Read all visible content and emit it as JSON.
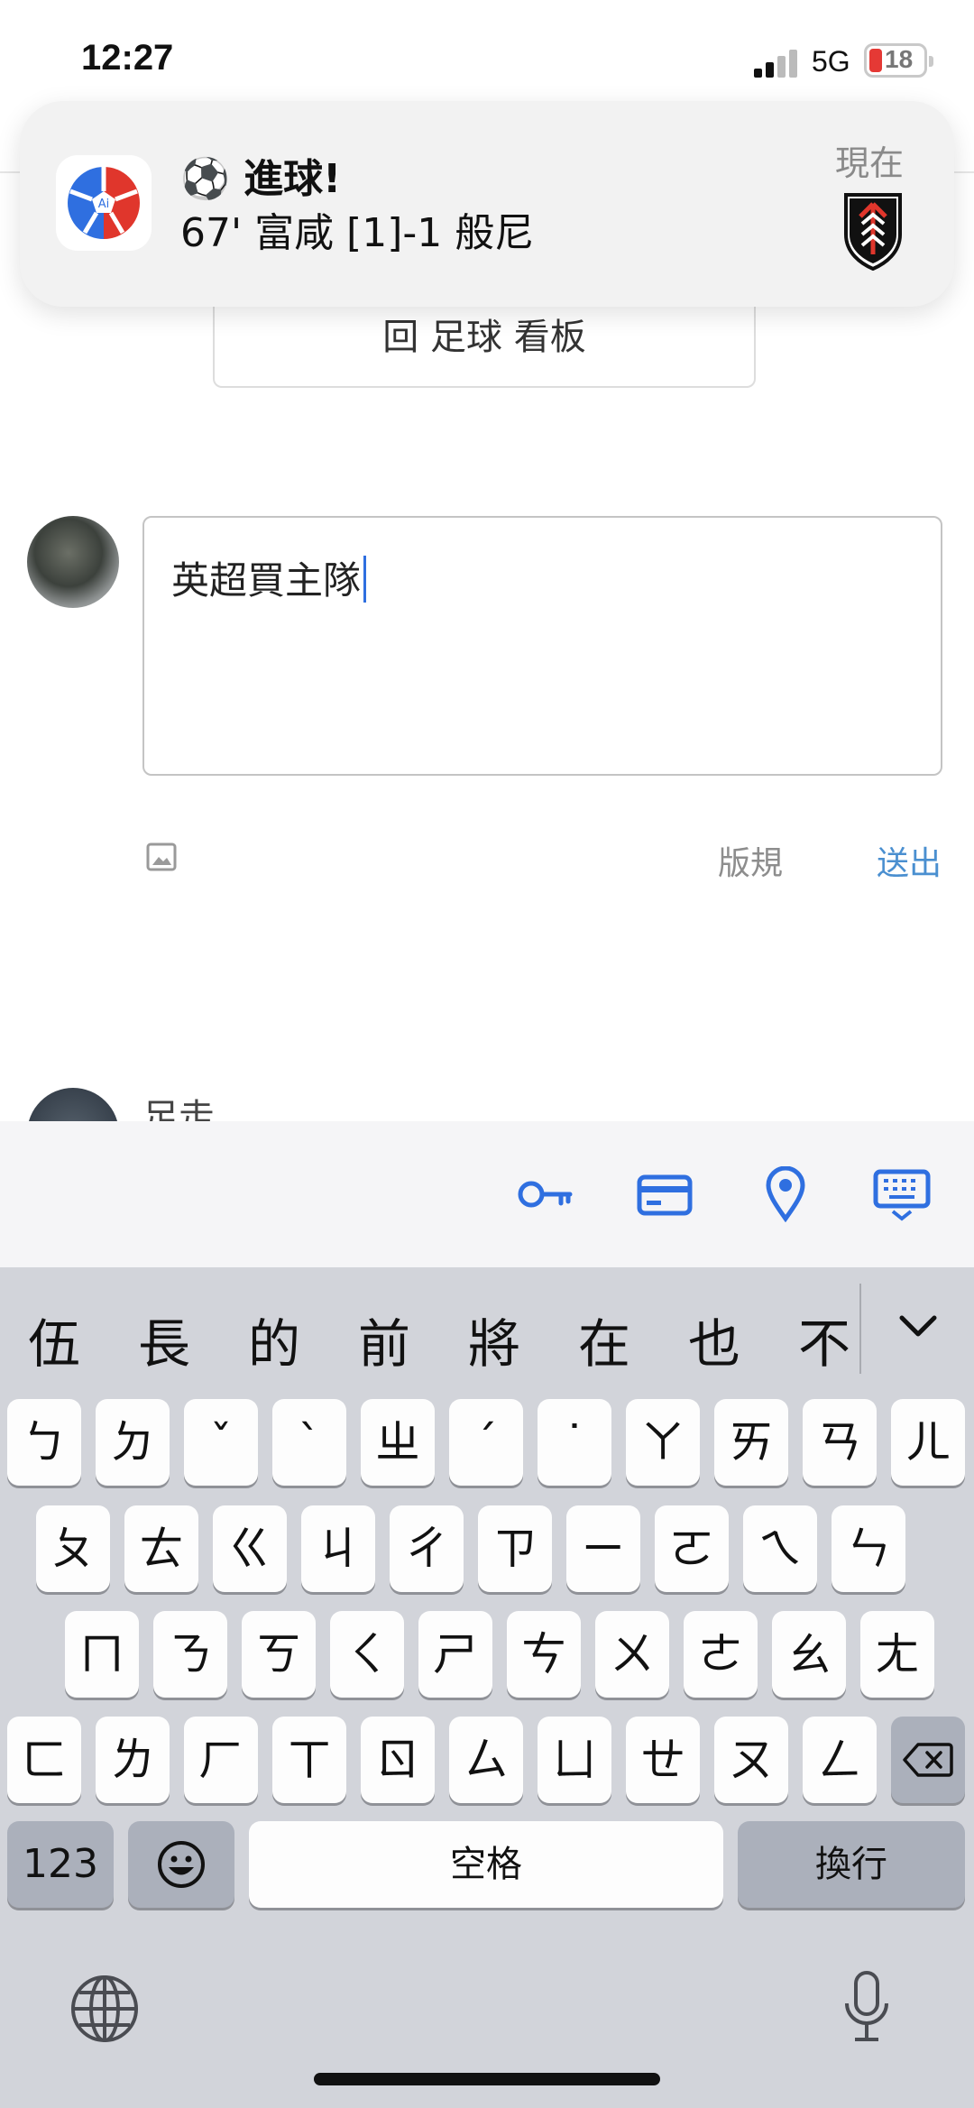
{
  "status_bar": {
    "time": "12:27",
    "network": "5G",
    "battery": "18",
    "battery_level": 0.18,
    "battery_color": "#e53935"
  },
  "notification": {
    "app_icon": "ball-app-icon",
    "title": "⚽ 進球!",
    "body": "67' 富咸 [1]-1 般尼",
    "time": "現在",
    "team_logo": "fulham-crest-icon"
  },
  "back_button": {
    "label": "回 足球 看板"
  },
  "comment": {
    "text": "英超買主隊",
    "rules_label": "版規",
    "submit_label": "送出",
    "submit_color": "#4a8fd0",
    "image_icon": "image-icon"
  },
  "next_comment": {
    "name": "足走"
  },
  "autofill_bar": {
    "icons": [
      "key-icon",
      "credit-card-icon",
      "location-pin-icon",
      "keyboard-hide-icon"
    ],
    "accent": "#2f6fe0"
  },
  "keyboard": {
    "candidates": [
      "伍",
      "長",
      "的",
      "前",
      "將",
      "在",
      "也",
      "不"
    ],
    "row1": [
      "ㄅ",
      "ㄉ",
      "ˇ",
      "ˋ",
      "ㄓ",
      "ˊ",
      "˙",
      "ㄚ",
      "ㄞ",
      "ㄢ",
      "ㄦ"
    ],
    "row2": [
      "ㄆ",
      "ㄊ",
      "ㄍ",
      "ㄐ",
      "ㄔ",
      "ㄗ",
      "ㄧ",
      "ㄛ",
      "ㄟ",
      "ㄣ"
    ],
    "row3": [
      "ㄇ",
      "ㄋ",
      "ㄎ",
      "ㄑ",
      "ㄕ",
      "ㄘ",
      "ㄨ",
      "ㄜ",
      "ㄠ",
      "ㄤ"
    ],
    "row4": [
      "ㄈ",
      "ㄌ",
      "ㄏ",
      "ㄒ",
      "ㄖ",
      "ㄙ",
      "ㄩ",
      "ㄝ",
      "ㄡ",
      "ㄥ"
    ],
    "numbers_key": "123",
    "space_key": "空格",
    "return_key": "換行"
  }
}
